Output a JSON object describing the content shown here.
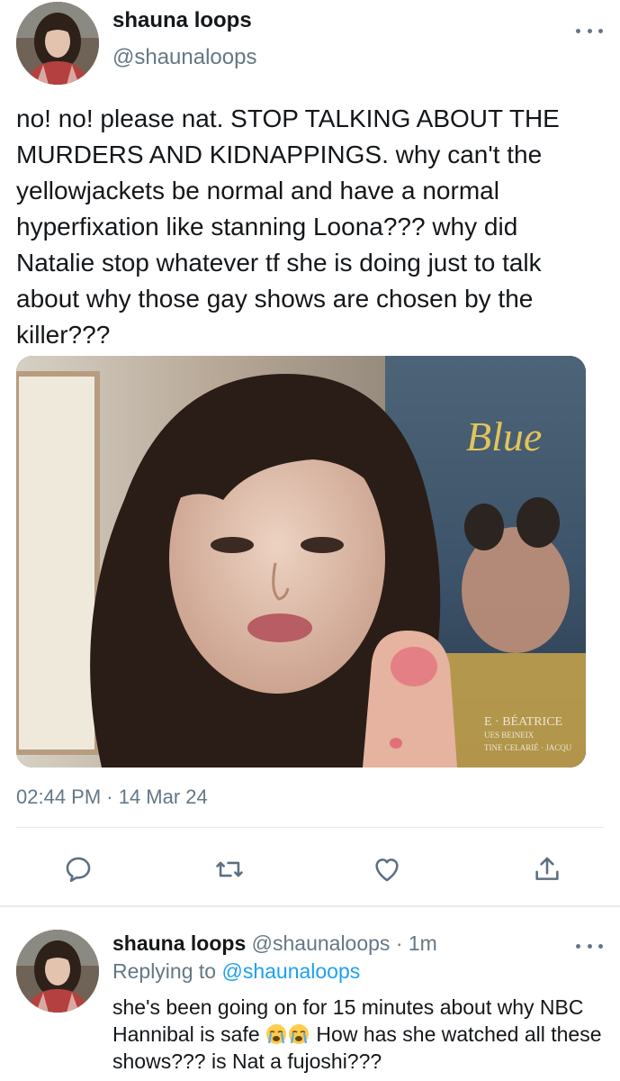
{
  "main_tweet": {
    "author": {
      "display_name": "shauna loops",
      "handle": "@shaunaloops"
    },
    "more_icon": "more-horizontal-icon",
    "text": "no! no! please nat. STOP TALKING ABOUT THE MURDERS AND KIDNAPPINGS. why can't the yellowjackets be normal and have a normal hyperfixation like stanning Loona??? why did Natalie stop whatever tf she is doing just to talk about why those gay shows are chosen by the killer???",
    "media": {
      "poster_title": "Blue",
      "poster_credit_line1": "E · BÉATRICE",
      "poster_credit_line2": "UES BEINEIX",
      "poster_credit_line3": "TINE CELARIÉ · JACQU"
    },
    "timestamp": "02:44 PM · 14 Mar 24",
    "actions": [
      {
        "name": "reply",
        "icon": "reply-icon"
      },
      {
        "name": "retweet",
        "icon": "retweet-icon"
      },
      {
        "name": "like",
        "icon": "heart-icon"
      },
      {
        "name": "share",
        "icon": "share-icon"
      }
    ]
  },
  "reply_tweet": {
    "author": {
      "display_name": "shauna loops",
      "handle": "@shaunaloops"
    },
    "meta_separator": " · ",
    "time_ago": "1m",
    "replying_to_label": "Replying to ",
    "replying_to_handle": "@shaunaloops",
    "text_part1": "she's been going on for 15 minutes about why NBC Hannibal is safe ",
    "emoji": "loudly-crying-face",
    "text_part2": " How has she watched all these shows??? is Nat a fujoshi???",
    "more_icon": "more-horizontal-icon"
  },
  "colors": {
    "text_primary": "#14171a",
    "text_secondary": "#657786",
    "link": "#1da1f2",
    "divider": "#e1e8ed",
    "icon": "#5b7083"
  }
}
